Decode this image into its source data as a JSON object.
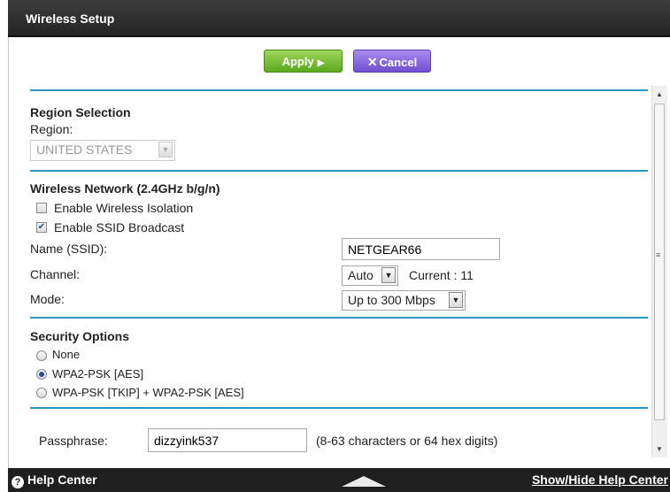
{
  "header": {
    "title": "Wireless Setup"
  },
  "toolbar": {
    "apply_label": "Apply",
    "apply_glyph": "▶",
    "cancel_label": "Cancel",
    "cancel_glyph": "✕"
  },
  "region": {
    "heading": "Region Selection",
    "label": "Region:",
    "value": "UNITED STATES"
  },
  "wireless": {
    "heading": "Wireless Network (2.4GHz b/g/n)",
    "isolation_label": "Enable Wireless Isolation",
    "isolation_checked": false,
    "broadcast_label": "Enable SSID Broadcast",
    "broadcast_checked": true,
    "ssid_label": "Name (SSID):",
    "ssid_value": "NETGEAR66",
    "channel_label": "Channel:",
    "channel_value": "Auto",
    "current_channel": "Current : 11",
    "mode_label": "Mode:",
    "mode_value": "Up to 300 Mbps"
  },
  "security": {
    "heading": "Security Options",
    "options": [
      "None",
      "WPA2-PSK [AES]",
      "WPA-PSK [TKIP] + WPA2-PSK [AES]"
    ],
    "selected": "WPA2-PSK [AES]"
  },
  "passphrase": {
    "label": "Passphrase:",
    "value": "dizzyink537",
    "hint": "(8-63 characters or 64 hex digits)"
  },
  "footer": {
    "help_label": "Help Center",
    "help_icon": "?",
    "toggle_label": "Show/Hide Help Center"
  },
  "colors": {
    "accent": "#2b95c6",
    "apply": "#7cc13c",
    "cancel": "#8b6be0",
    "bar": "#1f1f1f"
  }
}
